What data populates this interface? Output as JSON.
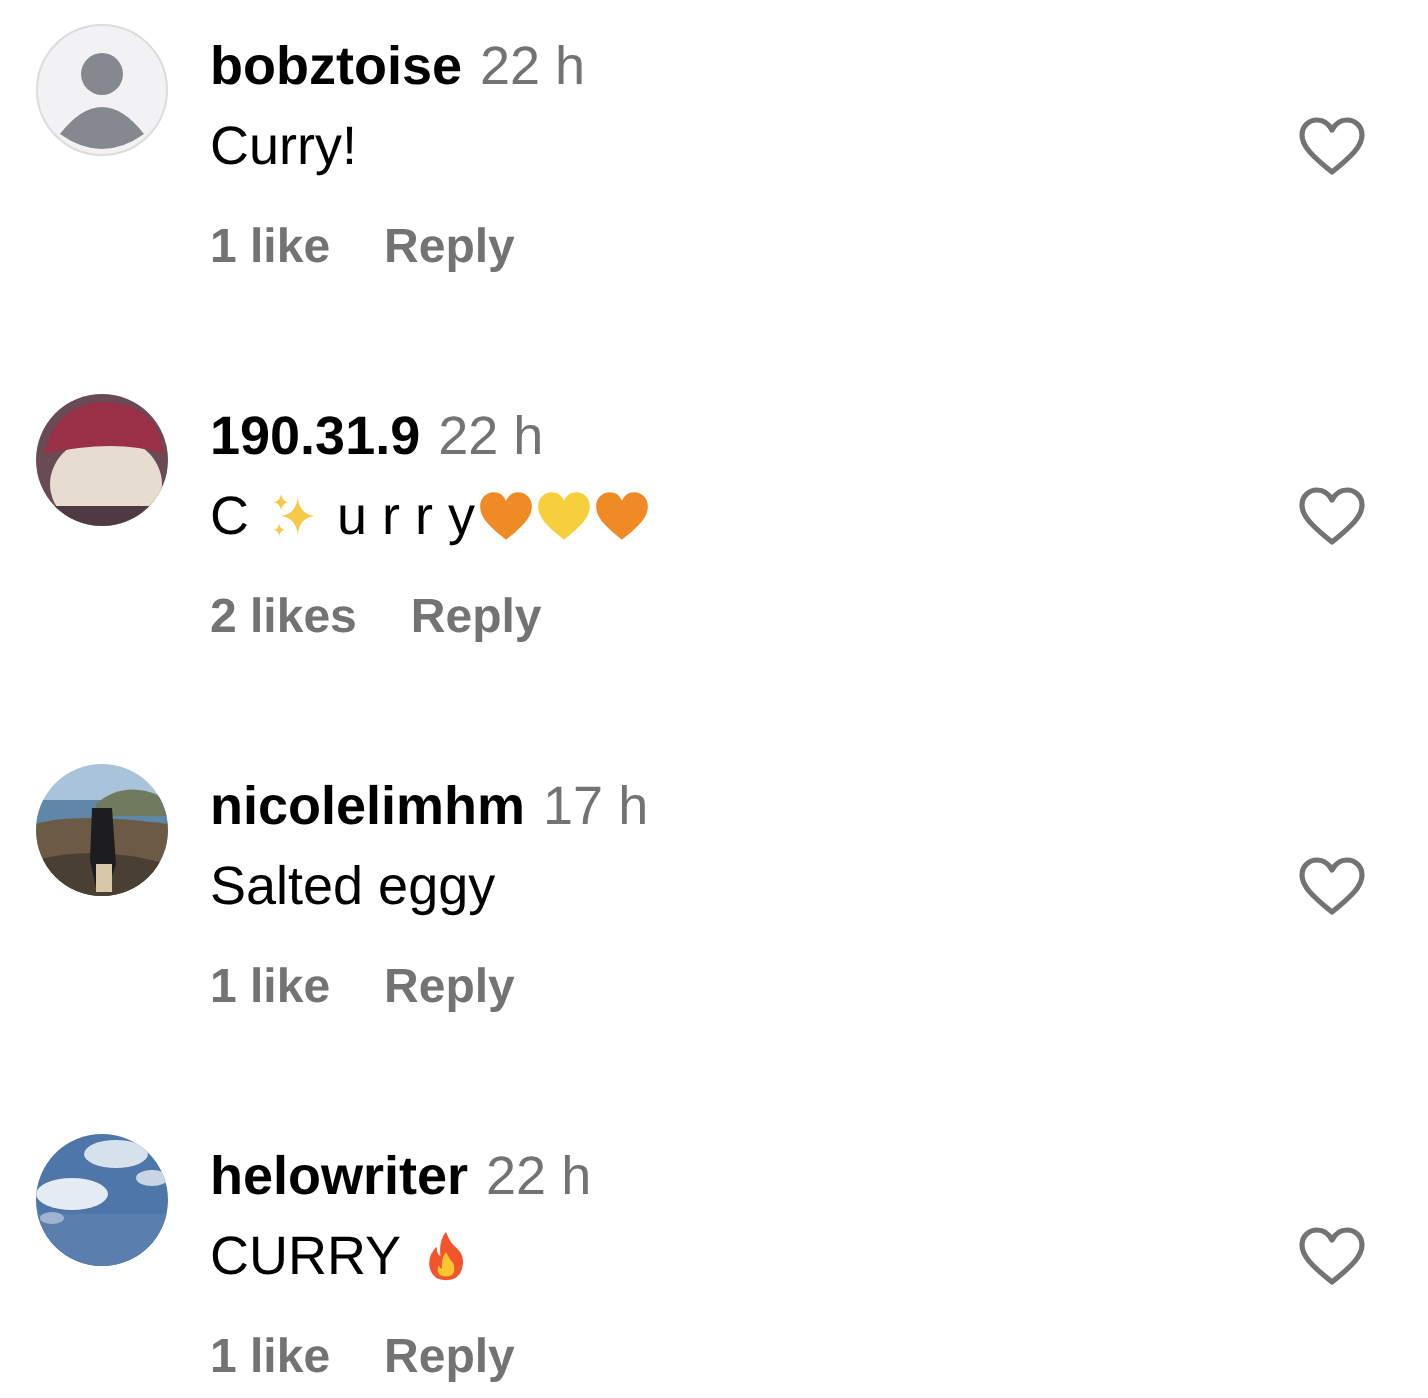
{
  "comments": [
    {
      "username": "bobztoise",
      "time": "22 h",
      "avatar": {
        "kind": "silhouette"
      },
      "body": [
        {
          "kind": "text",
          "text": "Curry!"
        }
      ],
      "likes": "1 like",
      "reply": "Reply",
      "liked": false
    },
    {
      "username": "190.31.9",
      "time": "22 h",
      "avatar": {
        "kind": "picture"
      },
      "body": [
        {
          "kind": "text",
          "text": "C"
        },
        {
          "kind": "sparkles"
        },
        {
          "kind": "text",
          "text": "u r r y"
        },
        {
          "kind": "heart",
          "color": "#f08a24"
        },
        {
          "kind": "heart",
          "color": "#f7cf3c"
        },
        {
          "kind": "heart",
          "color": "#f08a24"
        }
      ],
      "likes": "2 likes",
      "reply": "Reply",
      "liked": false
    },
    {
      "username": "nicolelimhm",
      "time": "17 h",
      "avatar": {
        "kind": "picture"
      },
      "body": [
        {
          "kind": "text",
          "text": "Salted eggy"
        }
      ],
      "likes": "1 like",
      "reply": "Reply",
      "liked": false
    },
    {
      "username": "helowriter",
      "time": "22 h",
      "avatar": {
        "kind": "picture"
      },
      "body": [
        {
          "kind": "text",
          "text": "CURRY"
        },
        {
          "kind": "fire"
        }
      ],
      "likes": "1 like",
      "reply": "Reply",
      "liked": false
    }
  ]
}
